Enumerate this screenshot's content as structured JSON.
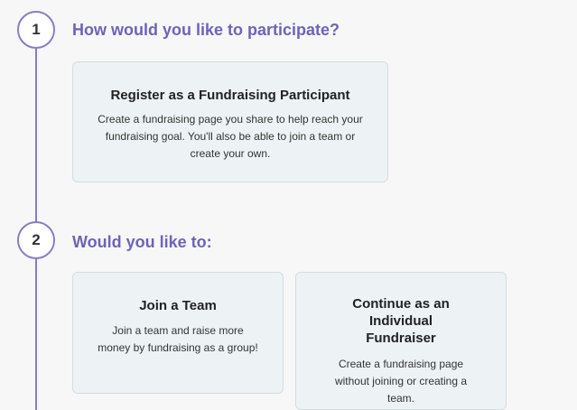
{
  "step1": {
    "number": "1",
    "title": "How would you like to participate?",
    "option": {
      "title": "Register as a Fundraising Participant",
      "description": "Create a fundraising page you share to help reach your fundraising goal. You'll also be able to join a team or create your own."
    }
  },
  "step2": {
    "number": "2",
    "title": "Would you like to:",
    "options": [
      {
        "title": "Join a Team",
        "description": "Join a team and raise more money by fundraising as a group!"
      },
      {
        "title": "Continue as an Individual Fundraiser",
        "description": "Create a fundraising page without joining or creating a team."
      }
    ]
  },
  "colors": {
    "accent": "#6f63b8",
    "timeline": "#8a7cc4",
    "card_bg": "#edf3f4",
    "card_border": "#d2dde0"
  }
}
